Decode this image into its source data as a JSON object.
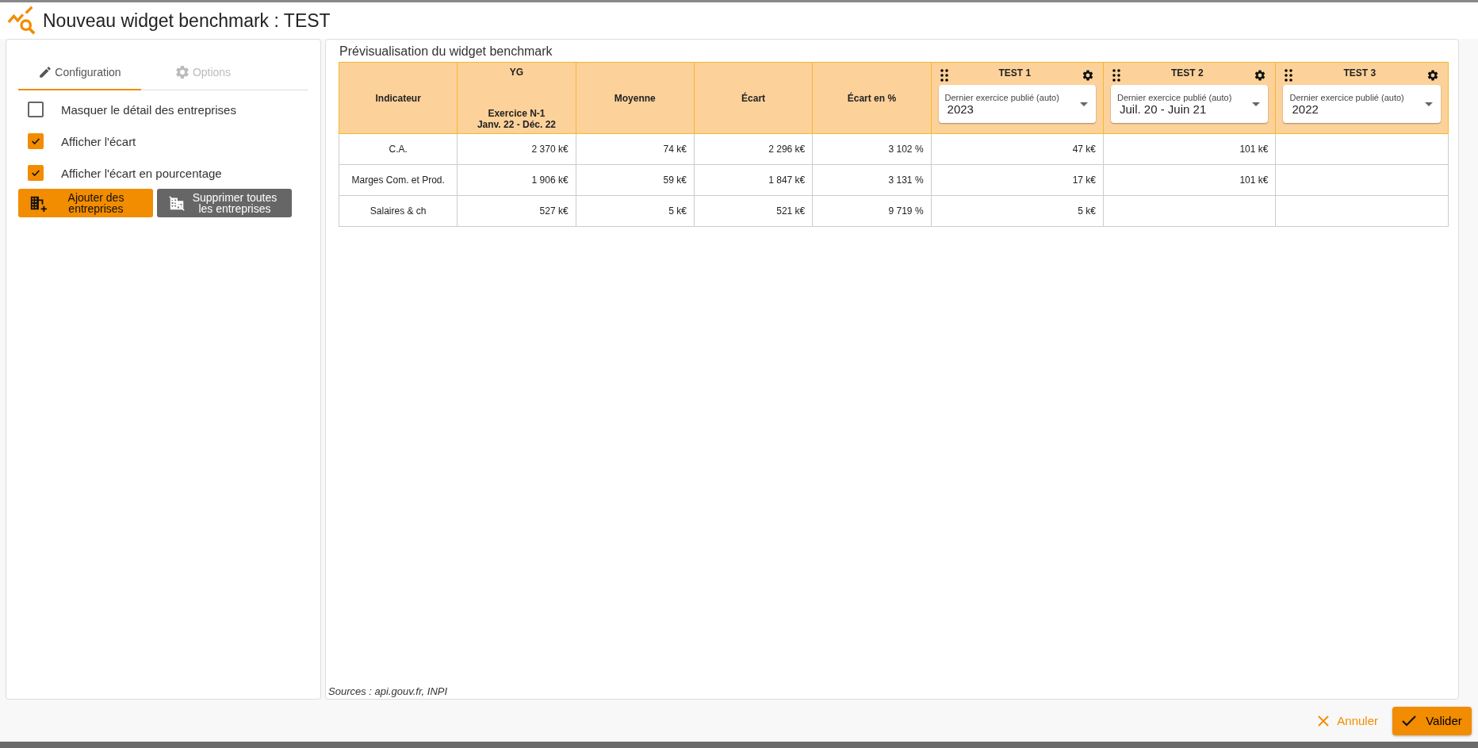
{
  "window": {
    "title": "Nouveau widget benchmark : TEST"
  },
  "tabs": [
    {
      "label": "Configuration",
      "selected": true,
      "kind": "pencil"
    },
    {
      "label": "Options",
      "selected": false,
      "kind": "gear"
    }
  ],
  "options": [
    {
      "label": "Masquer le détail des entreprises",
      "checked": false
    },
    {
      "label": "Afficher l'écart",
      "checked": true
    },
    {
      "label": "Afficher l'écart en pourcentage",
      "checked": true
    }
  ],
  "actions": [
    {
      "label": "Ajouter des entreprises",
      "kind": "add"
    },
    {
      "label": "Supprimer toutes les entreprises",
      "kind": "remove"
    }
  ],
  "preview": {
    "title": "Prévisualisation du widget benchmark",
    "columns": [
      {
        "kind": "plain",
        "label": "Indicateur"
      },
      {
        "kind": "company",
        "label": "YG",
        "sub1": "Exercice N-1",
        "sub2": "Janv. 22 - Déc. 22"
      },
      {
        "kind": "plain",
        "label": "Moyenne"
      },
      {
        "kind": "plain",
        "label": "Écart"
      },
      {
        "kind": "plain",
        "label": "Écart en %"
      },
      {
        "kind": "peer",
        "label": "TEST 1",
        "field_label": "Dernier exercice publié (auto)",
        "value": "2023"
      },
      {
        "kind": "peer",
        "label": "TEST 2",
        "field_label": "Dernier exercice publié (auto)",
        "value": "Juil. 20 - Juin 21"
      },
      {
        "kind": "peer",
        "label": "TEST 3",
        "field_label": "Dernier exercice publié (auto)",
        "value": "2022"
      }
    ],
    "rows": [
      [
        "C.A.",
        "2 370 k€",
        "74 k€",
        "2 296 k€",
        "3 102 %",
        "47 k€",
        "101 k€",
        ""
      ],
      [
        "Marges Com. et Prod.",
        "1 906 k€",
        "59 k€",
        "1 847 k€",
        "3 131 %",
        "17 k€",
        "101 k€",
        ""
      ],
      [
        "Salaires & ch",
        "527 k€",
        "5 k€",
        "521 k€",
        "9 719 %",
        "5 k€",
        "",
        ""
      ]
    ],
    "sources": "Sources : api.gouv.fr, INPI"
  },
  "footer": {
    "cancel": "Annuler",
    "confirm": "Valider"
  }
}
